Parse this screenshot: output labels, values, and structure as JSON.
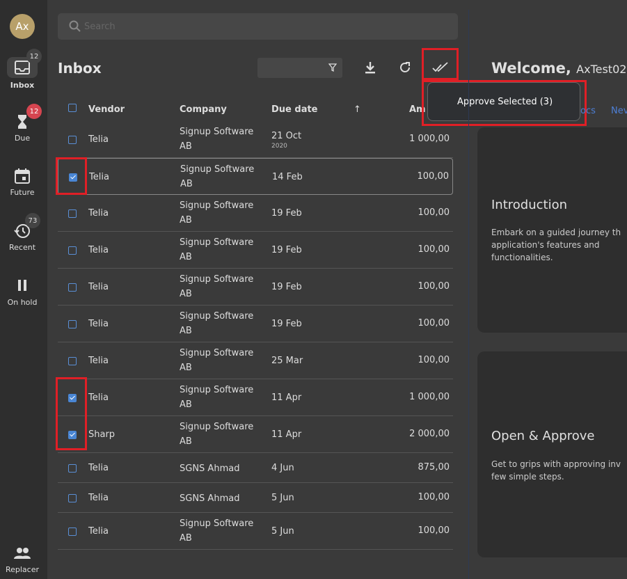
{
  "user": {
    "initials": "Ax",
    "name": "AxTest02"
  },
  "nav": [
    {
      "label": "Inbox",
      "badge": "12",
      "badge_color": "#444444",
      "icon": "inbox-icon"
    },
    {
      "label": "Due",
      "badge": "12",
      "badge_color": "#d64550",
      "icon": "hourglass-icon"
    },
    {
      "label": "Future",
      "badge": "",
      "icon": "calendar-icon"
    },
    {
      "label": "Recent",
      "badge": "73",
      "badge_color": "#444444",
      "icon": "history-icon"
    },
    {
      "label": "On hold",
      "badge": "",
      "icon": "pause-icon"
    },
    {
      "label": "Replacer",
      "badge": "",
      "icon": "people-icon"
    }
  ],
  "search": {
    "placeholder": "Search",
    "value": ""
  },
  "inbox": {
    "title": "Inbox",
    "filter_value": ""
  },
  "columns": {
    "vendor": "Vendor",
    "company": "Company",
    "due": "Due date",
    "sort_indicator": "↑",
    "amount": "Am"
  },
  "rows": [
    {
      "vendor": "Telia",
      "company": "Signup Software AB",
      "due": "21 Oct",
      "due_sub": "2020",
      "amount": "1 000,00",
      "checked": false
    },
    {
      "vendor": "Telia",
      "company": "Signup Software AB",
      "due": "14 Feb",
      "due_sub": "",
      "amount": "100,00",
      "checked": true
    },
    {
      "vendor": "Telia",
      "company": "Signup Software AB",
      "due": "19 Feb",
      "due_sub": "",
      "amount": "100,00",
      "checked": false
    },
    {
      "vendor": "Telia",
      "company": "Signup Software AB",
      "due": "19 Feb",
      "due_sub": "",
      "amount": "100,00",
      "checked": false
    },
    {
      "vendor": "Telia",
      "company": "Signup Software AB",
      "due": "19 Feb",
      "due_sub": "",
      "amount": "100,00",
      "checked": false
    },
    {
      "vendor": "Telia",
      "company": "Signup Software AB",
      "due": "19 Feb",
      "due_sub": "",
      "amount": "100,00",
      "checked": false
    },
    {
      "vendor": "Telia",
      "company": "Signup Software AB",
      "due": "25 Mar",
      "due_sub": "",
      "amount": "100,00",
      "checked": false
    },
    {
      "vendor": "Telia",
      "company": "Signup Software AB",
      "due": "11 Apr",
      "due_sub": "",
      "amount": "1 000,00",
      "checked": true
    },
    {
      "vendor": "Sharp",
      "company": "Signup Software AB",
      "due": "11 Apr",
      "due_sub": "",
      "amount": "2 000,00",
      "checked": true
    },
    {
      "vendor": "Telia",
      "company": "SGNS Ahmad",
      "due": "4 Jun",
      "due_sub": "",
      "amount": "875,00",
      "checked": false
    },
    {
      "vendor": "Telia",
      "company": "SGNS Ahmad",
      "due": "5 Jun",
      "due_sub": "",
      "amount": "100,00",
      "checked": false
    },
    {
      "vendor": "Telia",
      "company": "Signup Software AB",
      "due": "5 Jun",
      "due_sub": "",
      "amount": "100,00",
      "checked": false
    }
  ],
  "popover": {
    "label": "Approve Selected (3)"
  },
  "welcome": {
    "greeting": "Welcome,"
  },
  "tabs": [
    "ocs",
    "Nev"
  ],
  "cards": [
    {
      "title": "Introduction",
      "text": "Embark on a guided journey th application's features and functionalities."
    },
    {
      "title": "Open & Approve",
      "text": "Get to grips with approving inv few simple steps."
    }
  ],
  "colors": {
    "accent": "#4a86d4",
    "highlight": "#e01f26",
    "background": "#3a3a3a",
    "sidebar": "#2e2e2e"
  }
}
